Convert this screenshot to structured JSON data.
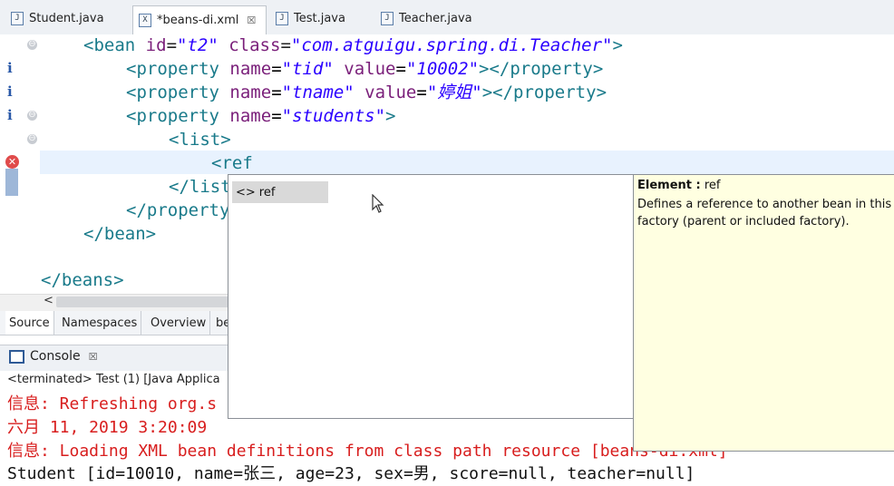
{
  "tabs": [
    {
      "label": "Student.java",
      "icon": "java-file-icon",
      "active": false
    },
    {
      "label": "*beans-di.xml",
      "icon": "xml-file-icon",
      "active": true,
      "close": "☒"
    },
    {
      "label": "Test.java",
      "icon": "java-file-icon",
      "active": false
    },
    {
      "label": "Teacher.java",
      "icon": "java-file-icon",
      "active": false
    }
  ],
  "code": {
    "l1": {
      "open": "<",
      "tag": "bean",
      "sp1": " ",
      "a1": "id",
      "eq1": "=",
      "v1": "\"t2\"",
      "sp2": " ",
      "a2": "class",
      "eq2": "=",
      "v2": "\"com.atguigu.spring.di.Teacher\"",
      "close": ">"
    },
    "l2": {
      "open": "<",
      "tag": "property",
      "a1": "name",
      "v1": "\"tid\"",
      "a2": "value",
      "v2": "\"10002\"",
      "end": "></",
      "etag": "property",
      "close": ">"
    },
    "l3": {
      "open": "<",
      "tag": "property",
      "a1": "name",
      "v1": "\"tname\"",
      "a2": "value",
      "v2": "\"婷姐\"",
      "end": "></",
      "etag": "property",
      "close": ">"
    },
    "l4": {
      "open": "<",
      "tag": "property",
      "a1": "name",
      "v1": "\"students\"",
      "close": ">"
    },
    "l5": {
      "open": "<",
      "tag": "list",
      "close": ">"
    },
    "l6": {
      "open": "<",
      "tag": "ref"
    },
    "l7": {
      "open": "</",
      "tag": "list"
    },
    "l8": {
      "open": "</",
      "tag": "property"
    },
    "l9": {
      "open": "</",
      "tag": "bean",
      "close": ">"
    },
    "l10": {
      "open": "</",
      "tag": "beans",
      "close": ">"
    }
  },
  "gutter": {
    "info": "i",
    "fold": "⊖",
    "error": "✕"
  },
  "scroll_left": "<",
  "editor_tabs": [
    "Source",
    "Namespaces",
    "Overview",
    "be"
  ],
  "console": {
    "title": "Console",
    "close": "☒",
    "terminated": "<terminated> Test (1) [Java Applica",
    "lines": [
      {
        "text": "信息: Refreshing org.s",
        "color": "red"
      },
      {
        "text": "六月 11, 2019 3:20:09 ",
        "color": "red"
      },
      {
        "text": "信息: Loading XML bean definitions from class path resource [beans-di.xml]",
        "color": "red"
      },
      {
        "text": "Student [id=10010, name=张三, age=23, sex=男, score=null, teacher=null]",
        "color": "black"
      }
    ]
  },
  "content_assist": {
    "item_icon": "<>",
    "item": "ref"
  },
  "doc_popup": {
    "title_label": "Element :",
    "title_value": "ref",
    "body": "Defines a reference to another bean in this factory (parent or included factory)."
  },
  "colors": {
    "tag": "#197a8a",
    "attr": "#7a1f7a",
    "value": "#2a00ff",
    "error_text": "#d81e1e"
  }
}
